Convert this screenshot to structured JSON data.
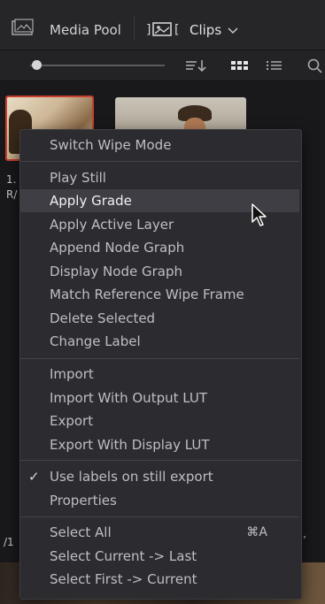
{
  "header": {
    "title": "Media Pool",
    "bin_selector": "Clips",
    "icons": [
      "media-pool-icon",
      "clips-bin-icon",
      "chevron-down-icon"
    ]
  },
  "toolbar": {
    "zoom_level": 0.05,
    "icons": [
      "sort-icon",
      "thumbnail-view-icon",
      "list-view-icon",
      "search-icon"
    ]
  },
  "clips": [
    {
      "label_prefix": "1.",
      "label_line2": "R/",
      "selected": true
    },
    {
      "label_prefix": "",
      "selected": false
    }
  ],
  "menu": {
    "groups": [
      [
        {
          "label": "Switch Wipe Mode"
        }
      ],
      [
        {
          "label": "Play Still"
        },
        {
          "label": "Apply Grade",
          "highlighted": true
        },
        {
          "label": "Apply Active Layer"
        },
        {
          "label": "Append Node Graph"
        },
        {
          "label": "Display Node Graph"
        },
        {
          "label": "Match Reference Wipe Frame"
        },
        {
          "label": "Delete Selected"
        },
        {
          "label": "Change Label"
        }
      ],
      [
        {
          "label": "Import"
        },
        {
          "label": "Import With Output LUT"
        },
        {
          "label": "Export"
        },
        {
          "label": "Export With Display LUT"
        }
      ],
      [
        {
          "label": "Use labels on still export",
          "checked": true,
          "check_mark": "✓"
        },
        {
          "label": "Properties"
        }
      ],
      [
        {
          "label": "Select All",
          "shortcut": "⌘A"
        },
        {
          "label": "Select Current -> Last"
        },
        {
          "label": "Select First -> Current"
        }
      ]
    ]
  },
  "peek_text": {
    "left_mid": "/1",
    "right_mid": "’"
  },
  "colors": {
    "selection_border": "#c5402f",
    "menu_bg": "#2c2c30",
    "menu_highlight": "#3e3e44",
    "header_bg": "#262629"
  }
}
